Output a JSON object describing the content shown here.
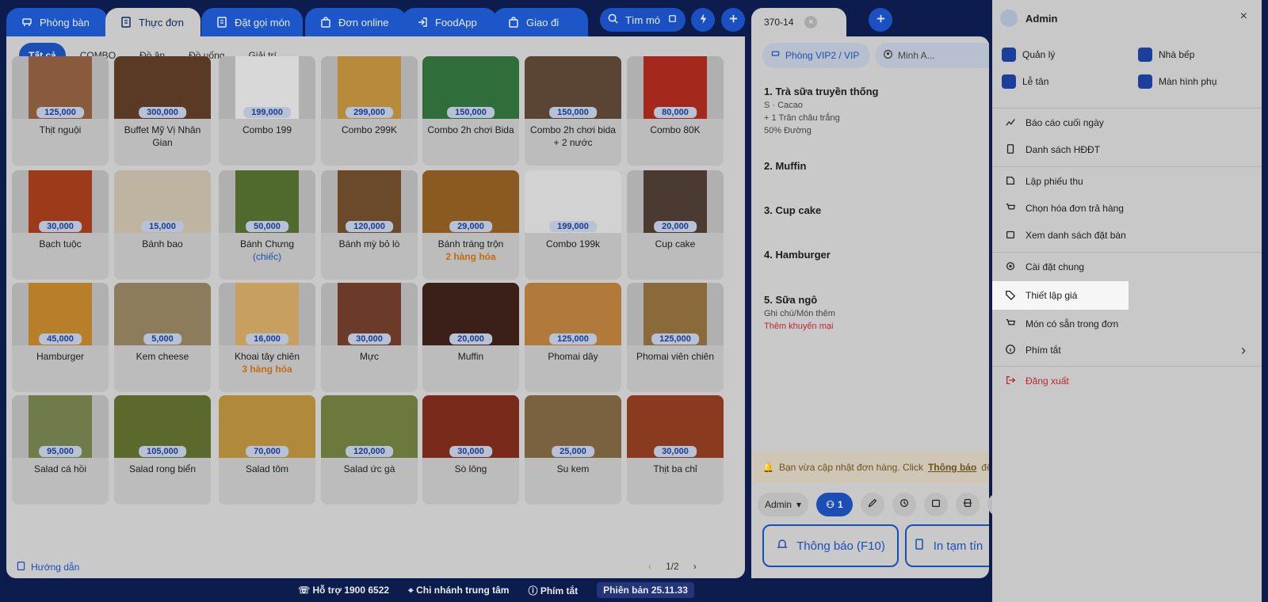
{
  "tabs": [
    {
      "label": "Phòng bàn",
      "icon": "table-icon"
    },
    {
      "label": "Thực đơn",
      "icon": "menu-icon",
      "active": true
    },
    {
      "label": "Đặt gọi món",
      "icon": "order-icon"
    },
    {
      "label": "Đơn online",
      "icon": "bag-icon"
    },
    {
      "label": "FoodApp",
      "icon": "login-icon"
    },
    {
      "label": "Giao đi",
      "icon": "bag-icon"
    }
  ],
  "search_label": "Tìm mó",
  "categories": [
    "Tất cả",
    "COMBO",
    "Đồ ăn",
    "Đồ uống",
    "Giải trí"
  ],
  "items": [
    {
      "name": "Thịt nguội",
      "price": "125,000",
      "color": "#8a5a3c"
    },
    {
      "name": "Buffet Mỹ Vị Nhân Gian",
      "price": "300,000",
      "color": "#5b3a25"
    },
    {
      "name": "Combo 199",
      "price": "199,000",
      "color": "#d8d8d8"
    },
    {
      "name": "Combo 299K",
      "price": "299,000",
      "color": "#b88a3c"
    },
    {
      "name": "Combo 2h chơi Bida",
      "price": "150,000",
      "color": "#2f6d3a"
    },
    {
      "name": "Combo 2h chơi bida + 2 nước",
      "price": "150,000",
      "color": "#5a4535"
    },
    {
      "name": "Combo 80K",
      "price": "80,000",
      "color": "#a5281d"
    },
    {
      "name": "Bạch tuộc",
      "price": "30,000",
      "color": "#9c3a1a"
    },
    {
      "name": "Bánh bao",
      "price": "15,000",
      "color": "#bfb3a2"
    },
    {
      "name": "Bánh Chưng",
      "price": "50,000",
      "sub": "(chiếc)",
      "subType": "blue",
      "color": "#4f6a2c"
    },
    {
      "name": "Bánh mỳ bỏ lò",
      "price": "120,000",
      "color": "#6b4a2b"
    },
    {
      "name": "Bánh tráng trộn",
      "price": "29,000",
      "sub": "2 hàng hóa",
      "subType": "orange",
      "color": "#8a5a20"
    },
    {
      "name": "Combo 199k",
      "price": "199,000",
      "color": "#d2d2d2"
    },
    {
      "name": "Cup cake",
      "price": "20,000",
      "color": "#4a3a32"
    },
    {
      "name": "Hamburger",
      "price": "45,000",
      "color": "#b97e2a"
    },
    {
      "name": "Kem cheese",
      "price": "5,000",
      "color": "#8c7c5c"
    },
    {
      "name": "Khoai tây chiên",
      "price": "16,000",
      "sub": "3 hàng hóa",
      "subType": "orange",
      "color": "#c7a060"
    },
    {
      "name": "Mực",
      "price": "30,000",
      "color": "#6b3a28"
    },
    {
      "name": "Muffin",
      "price": "20,000",
      "color": "#3a2018"
    },
    {
      "name": "Phomai dây",
      "price": "125,000",
      "color": "#b17a3a"
    },
    {
      "name": "Phomai viên chiên",
      "price": "125,000",
      "color": "#8a6a3a"
    },
    {
      "name": "Salad cá hồi",
      "price": "95,000",
      "color": "#6f7c4a"
    },
    {
      "name": "Salad rong biển",
      "price": "105,000",
      "color": "#5b6a2c"
    },
    {
      "name": "Salad tôm",
      "price": "70,000",
      "color": "#b08a3a"
    },
    {
      "name": "Salad ức gà",
      "price": "120,000",
      "color": "#6b7a3c"
    },
    {
      "name": "Sò lông",
      "price": "30,000",
      "color": "#7a2a1a"
    },
    {
      "name": "Su kem",
      "price": "25,000",
      "color": "#7a6240"
    },
    {
      "name": "Thịt ba chỉ",
      "price": "30,000",
      "color": "#8a3a1e"
    }
  ],
  "guide": "Hướng dẫn",
  "pager": {
    "current": "1/2",
    "prev": "‹",
    "next": "›"
  },
  "order": {
    "table": "370-14",
    "room": "Phòng VIP2 / VIP",
    "staff": "Minh A...",
    "lines": [
      {
        "title": "1. Trà sữa truyền thống",
        "details": [
          "S · Cacao",
          "+ 1 Trân châu trắng",
          "50% Đường"
        ]
      },
      {
        "title": "2. Muffin",
        "details": []
      },
      {
        "title": "3. Cup cake",
        "details": []
      },
      {
        "title": "4. Hamburger",
        "details": []
      },
      {
        "title": "5. Sữa ngô",
        "details": [
          "Ghi chú/Món thêm"
        ],
        "promo": "Thêm khuyến mại"
      }
    ],
    "notice": "Bạn vừa cập nhật đơn hàng. Click",
    "notice_link": "Thông báo",
    "notice_tail": "để g",
    "user": "Admin",
    "guests": "1",
    "btn_notify": "Thông báo (F10)",
    "btn_print": "In tạm tín"
  },
  "account": {
    "name": "Admin",
    "close": "×",
    "roles": [
      "Quản lý",
      "Nhà bếp",
      "Lễ tân",
      "Màn hình phụ"
    ],
    "menu": [
      "Báo cáo cuối ngày",
      "Danh sách HĐĐT",
      "Lập phiếu thu",
      "Chọn hóa đơn trả hàng",
      "Xem danh sách đặt bàn",
      "Cài đặt chung",
      "Thiết lập giá",
      "Món có sẵn trong đơn",
      "Phím tắt",
      "Đăng xuất"
    ]
  },
  "status": {
    "support": "Hỗ trợ 1900 6522",
    "branch": "Chi nhánh trung tâm",
    "shortcut": "Phím tắt",
    "version": "Phiên bản 25.11.33"
  }
}
